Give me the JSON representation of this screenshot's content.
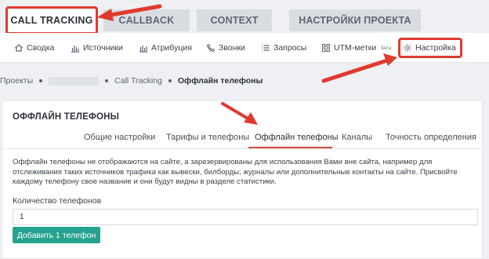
{
  "top_tabs": [
    {
      "label": "CALL TRACKING",
      "active": true
    },
    {
      "label": "CALLBACK",
      "active": false
    },
    {
      "label": "CONTEXT",
      "active": false
    },
    {
      "label": "НАСТРОЙКИ ПРОЕКТА",
      "active": false
    }
  ],
  "subnav": {
    "items": [
      {
        "label": "Сводка",
        "icon": "home-icon"
      },
      {
        "label": "Источники",
        "icon": "bar-chart-icon"
      },
      {
        "label": "Атрибуция",
        "icon": "bar-chart-icon"
      },
      {
        "label": "Звонки",
        "icon": "phone-icon"
      },
      {
        "label": "Запросы",
        "icon": "list-icon"
      },
      {
        "label": "UTM-метки",
        "icon": "grid-icon",
        "badge": "Бета"
      },
      {
        "label": "Настройка",
        "icon": "gear-icon"
      }
    ]
  },
  "breadcrumb": {
    "root": "Проекты",
    "section": "Call Tracking",
    "current": "Оффлайн телефоны"
  },
  "card": {
    "title": "ОФФЛАЙН ТЕЛЕФОНЫ",
    "tabs": [
      {
        "label": "Общие настройки",
        "active": false
      },
      {
        "label": "Тарифы и телефоны",
        "active": false
      },
      {
        "label": "Оффлайн телефоны",
        "active": true
      },
      {
        "label": "Каналы",
        "active": false
      },
      {
        "label": "Точность определения",
        "active": false
      }
    ],
    "description": "Оффлайн телефоны не отображаются на сайте, а зарезервированы для использования Вами вне сайта, например для отслеживания таких источников трафика как вывески, билборды, журналы или дополнительные контакты на сайте. Присвойте каждому телефону свое название и они будут видны в разделе статистики.",
    "phones_count_label": "Количество телефонов",
    "phones_count_value": "1",
    "add_button_label": "Добавить 1 телефон"
  },
  "colors": {
    "highlight": "#e03a2f",
    "accent": "#26a38f",
    "active_underline": "#d34a3a"
  }
}
